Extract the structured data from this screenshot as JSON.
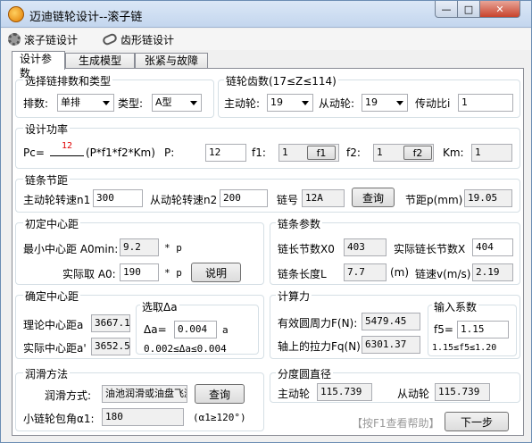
{
  "window": {
    "title": "迈迪链轮设计--滚子链"
  },
  "toolbar": {
    "roller_chain": "滚子链设计",
    "tooth_chain": "齿形链设计"
  },
  "tabs": [
    {
      "label": "设计参数"
    },
    {
      "label": "生成模型"
    },
    {
      "label": "张紧与故障"
    }
  ],
  "chain_type": {
    "title": "选择链排数和类型",
    "rows_label": "排数:",
    "rows_value": "单排",
    "type_label": "类型:",
    "type_value": "A型"
  },
  "teeth": {
    "title": "链轮齿数(17≤Z≤114)",
    "driver_label": "主动轮:",
    "driver_value": "19",
    "driven_label": "从动轮:",
    "driven_value": "19",
    "ratio_label": "传动比i",
    "ratio_value": "1"
  },
  "power": {
    "title": "设计功率",
    "formula_prefix": "Pc=",
    "formula_value": "12",
    "formula_rest": "(P*f1*f2*Km)",
    "p_label": "P:",
    "p_value": "12",
    "f1_label": "f1:",
    "f1_value": "1",
    "f1_button": "f1",
    "f2_label": "f2:",
    "f2_value": "1",
    "f2_button": "f2",
    "km_label": "Km:",
    "km_value": "1"
  },
  "pitch": {
    "title": "链条节距",
    "n1_label": "主动轮转速n1",
    "n1_value": "300",
    "n2_label": "从动轮转速n2",
    "n2_value": "200",
    "chain_no_label": "链号",
    "chain_no_value": "12A",
    "query_button": "查询",
    "pitch_label": "节距p(mm)",
    "pitch_value": "19.05"
  },
  "initial_center": {
    "title": "初定中心距",
    "min_label": "最小中心距 A0min:",
    "min_value": "9.2",
    "min_unit": "* p",
    "actual_label": "实际取 A0:",
    "actual_value": "190",
    "actual_unit": "* p",
    "explain_button": "说明"
  },
  "chain_params": {
    "title": "链条参数",
    "links_label": "链长节数X0",
    "links_value": "403",
    "actual_links_label": "实际链长节数X",
    "actual_links_value": "404",
    "length_label": "链条长度L",
    "length_value": "7.7",
    "length_unit": "(m)",
    "speed_label": "链速v(m/s)",
    "speed_value": "2.19"
  },
  "determine_center": {
    "title": "确定中心距",
    "theory_label": "理论中心距a",
    "theory_value": "3667.1",
    "actual_label": "实际中心距a'",
    "actual_value": "3652.5",
    "select_title": "选取Δa",
    "delta_label": "Δa=",
    "delta_value": "0.004",
    "delta_unit": "a",
    "range_text": "0.002≤Δa≤0.004"
  },
  "force": {
    "title": "计算力",
    "effective_label": "有效圆周力F(N):",
    "effective_value": "5479.45",
    "axial_label": "轴上的拉力Fq(N):",
    "axial_value": "6301.37",
    "coef_title": "输入系数",
    "f5_label": "f5=",
    "f5_value": "1.15",
    "f5_range": "1.15≤f5≤1.20"
  },
  "lubrication": {
    "title": "润滑方法",
    "method_label": "润滑方式:",
    "method_value": "油池润滑或油盘飞溅润滑",
    "query_button": "查询",
    "wrap_label": "小链轮包角α1:",
    "wrap_value": "180",
    "wrap_range": "(α1≥120°)"
  },
  "pitch_circle": {
    "title": "分度圆直径",
    "driver_label": "主动轮",
    "driver_value": "115.739",
    "driven_label": "从动轮",
    "driven_value": "115.739"
  },
  "footer": {
    "hint": "【按F1查看帮助】",
    "next_button": "下一步"
  },
  "colors": {
    "formula_value": "#e00000",
    "title_bar": "#c3d6ee",
    "close_button": "#c8432c"
  }
}
